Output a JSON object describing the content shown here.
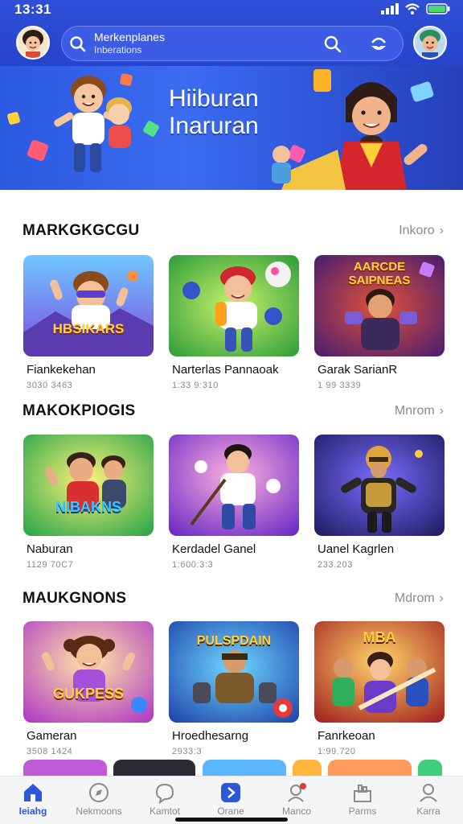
{
  "status_bar": {
    "time": "13:31"
  },
  "header": {
    "search_text": "Merkenplanes",
    "search_subtext": "Inberations",
    "brand_color": "#2f4fd8"
  },
  "banner": {
    "title_line1": "Hiiburan",
    "title_line2": "Inaruran"
  },
  "sections": [
    {
      "title": "MARKGKGCGU",
      "more": "Inkoro",
      "games": [
        {
          "name": "Fiankekehan",
          "meta": "3030 3463",
          "art": "HBSIKARS"
        },
        {
          "name": "Narterlas Pannaoak",
          "meta": "1:33 9:310",
          "art": ""
        },
        {
          "name": "Garak SarianR",
          "meta": "1 99 3339",
          "art": "AARCDE SAIPNEAS"
        }
      ]
    },
    {
      "title": "MAKOKPIOGIS",
      "more": "Mnrom",
      "games": [
        {
          "name": "Naburan",
          "meta": "1129 70C7",
          "art": "NIBAKNS"
        },
        {
          "name": "Kerdadel Ganel",
          "meta": "1:600:3:3",
          "art": ""
        },
        {
          "name": "Uanel Kagrlen",
          "meta": "233.203",
          "art": ""
        }
      ]
    },
    {
      "title": "MAUKGNONS",
      "more": "Mdrom",
      "games": [
        {
          "name": "Gameran",
          "meta": "3508 1424",
          "art": "GUKPESS"
        },
        {
          "name": "Hroedhesarng",
          "meta": "2933:3",
          "art": "PULSPDAIN"
        },
        {
          "name": "Fanrkeoan",
          "meta": "1:99.720",
          "art": "MBA"
        }
      ]
    }
  ],
  "bottom_nav": [
    {
      "label": "Ieiahg",
      "icon": "home-icon",
      "active": true
    },
    {
      "label": "Nekmoons",
      "icon": "compass-icon",
      "active": false
    },
    {
      "label": "Kamtot",
      "icon": "chat-icon",
      "active": false
    },
    {
      "label": "Orane",
      "icon": "play-icon",
      "active": false
    },
    {
      "label": "Manco",
      "icon": "notification-icon",
      "active": false
    },
    {
      "label": "Parms",
      "icon": "library-icon",
      "active": false
    },
    {
      "label": "Karra",
      "icon": "profile-icon",
      "active": false
    }
  ]
}
